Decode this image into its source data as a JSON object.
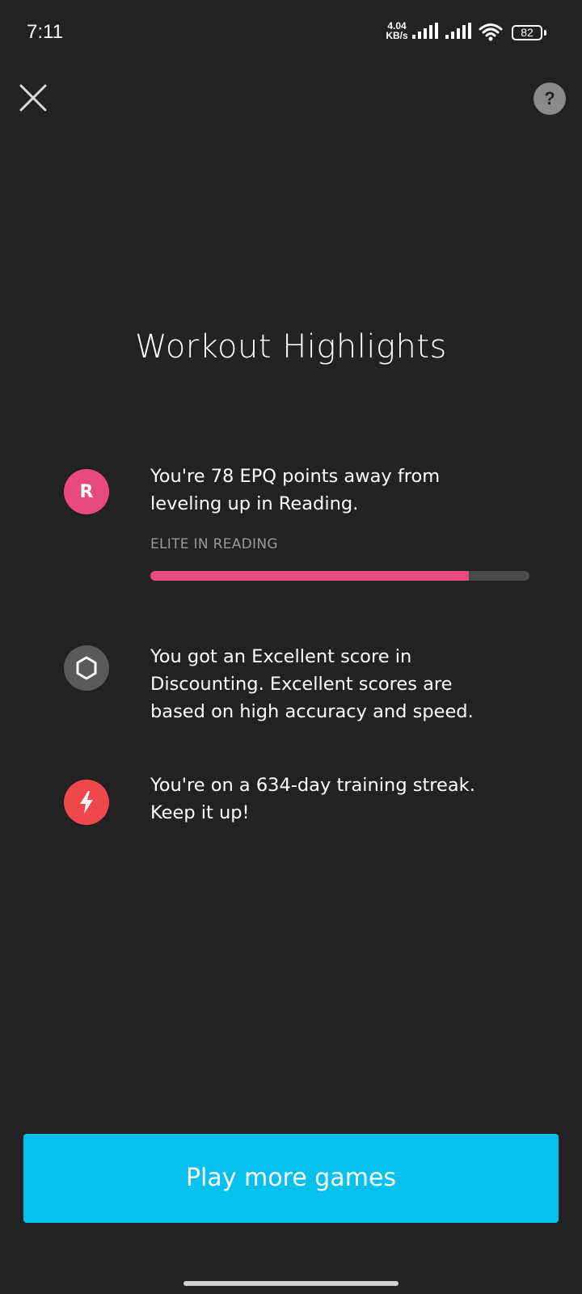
{
  "status_bar": {
    "time": "7:11",
    "net_speed_value": "4.04",
    "net_speed_unit": "KB/s",
    "battery": "82",
    "icons": [
      "signal-icon",
      "signal-icon",
      "wifi-icon",
      "battery-icon"
    ]
  },
  "header": {
    "close_icon": "close-icon",
    "help_label": "?"
  },
  "title": "Workout Highlights",
  "highlights": [
    {
      "icon": "reading-badge-icon",
      "icon_letter": "R",
      "icon_color": "#e84a7f",
      "text_line1": "You're 78 EPQ points away from",
      "text_line2": "leveling up in Reading.",
      "level_label": "ELITE IN READING",
      "progress": 0.84
    },
    {
      "icon": "hexagon-icon",
      "icon_color": "#5a5a5a",
      "text_line1": "You got an Excellent score in",
      "text_line2": "Discounting. Excellent scores are",
      "text_line3": "based on high accuracy and speed."
    },
    {
      "icon": "lightning-icon",
      "icon_color": "#f0474b",
      "text_line1": "You're on a 634-day training streak.",
      "text_line2": "Keep it up!"
    }
  ],
  "cta": {
    "label": "Play more games",
    "color": "#06c1ee"
  },
  "colors": {
    "background": "#222222",
    "accent_pink": "#e84a7f",
    "progress_track": "#4a4a4a"
  }
}
